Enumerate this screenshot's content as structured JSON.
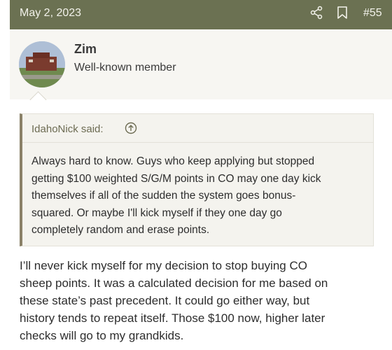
{
  "header": {
    "date": "May 2, 2023",
    "post_number": "#55",
    "share_icon": "share-icon",
    "bookmark_icon": "bookmark-icon"
  },
  "user": {
    "name": "Zim",
    "title": "Well-known member"
  },
  "quote": {
    "author": "IdahoNick said:",
    "text": "Always hard to know. Guys who keep applying but stopped\ngetting $100 weighted S/G/M points in CO may one day kick\nthemselves if all of the sudden the system goes bonus-\nsquared. Or maybe I'll kick myself if they one day go\ncompletely random and erase points."
  },
  "post": {
    "text": "I’ll never kick myself for my decision to stop buying CO\nsheep points. It was a calculated decision for me based on\nthese state’s past precedent. It could go either way, but\nhistory tends to repeat itself. Those $100 now, higher later\nchecks will go to my grandkids."
  },
  "colors": {
    "header_bg": "#6b7152",
    "quote_border": "#8a8168",
    "quote_author": "#6c6b52"
  }
}
